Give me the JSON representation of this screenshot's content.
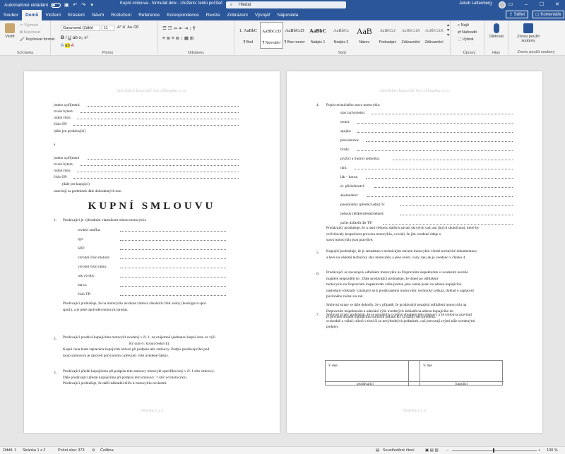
{
  "titlebar": {
    "autosave": "Automatické ukládání",
    "file_title": "Kupní smlouva - formulář.dotx  -  Uloženo: tento počítač",
    "search_placeholder": "Hledat",
    "user": "Jakub Lattenberg",
    "icons": [
      "save-icon",
      "undo-icon",
      "redo-icon",
      "minimize-icon",
      "maximize-icon",
      "close-icon"
    ]
  },
  "tabs": [
    "Soubor",
    "Domů",
    "Vložení",
    "Kreslení",
    "Návrh",
    "Rozložení",
    "Reference",
    "Korespondence",
    "Revize",
    "Zobrazení",
    "Vývojář",
    "Nápověda"
  ],
  "share": "Sdílet",
  "comments": "Komentáře",
  "ribbon": {
    "clipboard": {
      "label": "Schránka",
      "paste": "Vložit",
      "cut": "Vyjmout",
      "copy": "Kopírovat",
      "format": "Kopírovat formát"
    },
    "font": {
      "label": "Písmo",
      "name": "Garamond (Záklé",
      "size": "11"
    },
    "paragraph": {
      "label": "Odstavec"
    },
    "styles": {
      "label": "Styly",
      "items": [
        {
          "preview": "1. AaBbC",
          "name": "¶ Bod"
        },
        {
          "preview": "AaBbCcD",
          "name": "¶ Normální"
        },
        {
          "preview": "AaBbCcD",
          "name": "¶ Bez mezer"
        },
        {
          "preview": "AaBbC",
          "name": "Nadpis 1"
        },
        {
          "preview": "AaBbCc",
          "name": "Nadpis 2"
        },
        {
          "preview": "AaB",
          "name": "Název"
        },
        {
          "preview": "AaBbCcI",
          "name": "Podnadpis"
        },
        {
          "preview": "AaBbCcDt",
          "name": "Zdůraznění"
        },
        {
          "preview": "AaBbCcDt",
          "name": "Zdůraznění"
        }
      ]
    },
    "editing": {
      "label": "Úpravy",
      "find": "Najít",
      "replace": "Nahradit",
      "select": "Vybrat"
    },
    "voice": {
      "label": "Hlas",
      "dictate": "Diktovat"
    },
    "reuse": {
      "label": "Znovu použít soubory",
      "btn": "Znovu použít soubory"
    }
  },
  "page1": {
    "header": "Advokátní kancelář bez chloupku s.r.o.",
    "fields1": [
      "jméno a příjmení:",
      "trvale bytem:",
      "rodné číslo:",
      "číslo OP:"
    ],
    "seller": "(dále jen prodávající)",
    "and": "a",
    "fields2": [
      "jméno a příjmení",
      "trvale bytem:",
      "rodné číslo:",
      "číslo OP:"
    ],
    "buyer": "(dále jen kupující)",
    "intro": "uzavírají za podmínek dále dohodnutých tuto",
    "title": "KUPNÍ SMLOUVU",
    "s1_num": "1.",
    "s1_text": "Prodávající je výhradním vlastníkem tohoto motocyklu:",
    "moto_fields": [
      "tovární značka:",
      "typ:",
      "SPZ:",
      "výrobní číslo motoru:",
      "výrobní číslo rámu:",
      "rok výroby:",
      "barva:",
      "číslo TP:"
    ],
    "s1_note": [
      "Prodávající prohlašuje, že na motocyklu nevázne zástava zákaňolív třetí osoby (leasingová spol.",
      "spod.), a je plně oprávněn motocykl prodat."
    ],
    "s2_num": "2.",
    "s2_text": [
      "Prodávající prodává kupujícímu motocykl uvedený v čl. 1, za vzájemně sjednanou kupní cenu ve výši",
      "Kč (slovy:                                                        korun českých).",
      "Kupní cena bude zaplacena kupujícím hotově při podpisu této smlouvy. Podpis prodávajícího pod",
      "touto smlouvou je zároveň potvrzením o převzetí výše uvedené částky."
    ],
    "s3_num": "3.",
    "s3_text": [
      "Prodávající předal kupujícímu při podpisu této smlouvy motocykl specifikovaný v čl. 1 této smlouvy.",
      "Dále prodávající předal kupujícímu při podpisu této smlouvy:                         × klíč od motocyklu.",
      "Prodávající prohlašuje, že další náhradní klíče k motocyklu nevlastní."
    ],
    "footer": "Stránka 1 z 2"
  },
  "page2": {
    "header": "Advokátní kancelář bez chloupku s.r.o.",
    "s4_num": "4.",
    "s4_text": "Popis technického stavu motocyklu:",
    "tech_fields": [
      "stav tachometru:",
      "motor:",
      "spojka:",
      "převodovka:",
      "brzdy:",
      "pružící a tlumicí jednotka:",
      "rám:",
      "lak – barva:",
      "el. příslušenství:",
      "akumulátor:",
      "pneumatiky (přední/zadní) %:",
      "nebody (těžké/střední/lehké):",
      "počet držitelů dle TP:"
    ],
    "s4_note": [
      "Prodávající prohlašuje, že u není vědomo dalších závad, skrytých vad, ani jiných skutečností, které by",
      "ovlivňovaly bezpečnost provozu motocyklu, a uvádí, že jím uvedené údaje o",
      "stavu motocyklu jsou pravdivé."
    ],
    "s5_num": "5.",
    "s5_text": [
      "Kupující prohlašuje, že je seznámen s technickým stavem motocyklu včetně technické dokumentace,",
      "a bere na vědomí technický stav motocyklu a jeho event. vady, tak jak je uvedeno v článku 4."
    ],
    "s6_num": "6.",
    "s6_text": [
      "Prodávající se zavazuje k odhlášení motocyklu na Dopravním inspektorátu s uvedením nového",
      "majitele nejpozději do                                     . Dále prodávající prohlašuje, že ihned po odhlášení",
      "motocyklu na Dopravním inspektorátu zašle poštou jako cenné psaní na adresu kupujícího",
      "následující doklady vztahující se k prodávanému motocyklu: technický průkaz, doklad o zaplacení",
      "povinného ručení na rok                   ."
    ],
    "s6_text2": [
      "Smluvní strany se dále dohodly, že v případě, že prodávající nezajistí odhlášení motocyklu na",
      "Dopravním inspektorátu a odeslání výše uvedených dokladů na adresu kupujícího do",
      "je povinen uhradit kupujícímu smluvní pokutu                           Kč za každý den prodlení."
    ],
    "s7_num": "7.",
    "s7_text": [
      "Smluvní strany prohlašují, že se seznámily s celým obsahem této smlouvy a že smlouva uzavírají",
      "svobodně a vážně, nikoli v tísni či za nevýhodných podmínek, což potvrzují svými níže uvedenými",
      "podpisy."
    ],
    "sig_left": "V                             dne",
    "sig_right": "V                             dne",
    "sig_seller": "prodávající",
    "sig_buyer": "kupující",
    "footer": "Stránka 2 z 2"
  },
  "status": {
    "page": "Oddíl: 1",
    "pages": "Stránka 1 z 2",
    "words": "Počet slov: 373",
    "lang": "Čeština",
    "focus": "Soustředěné čtení",
    "zoom": "100 %"
  }
}
